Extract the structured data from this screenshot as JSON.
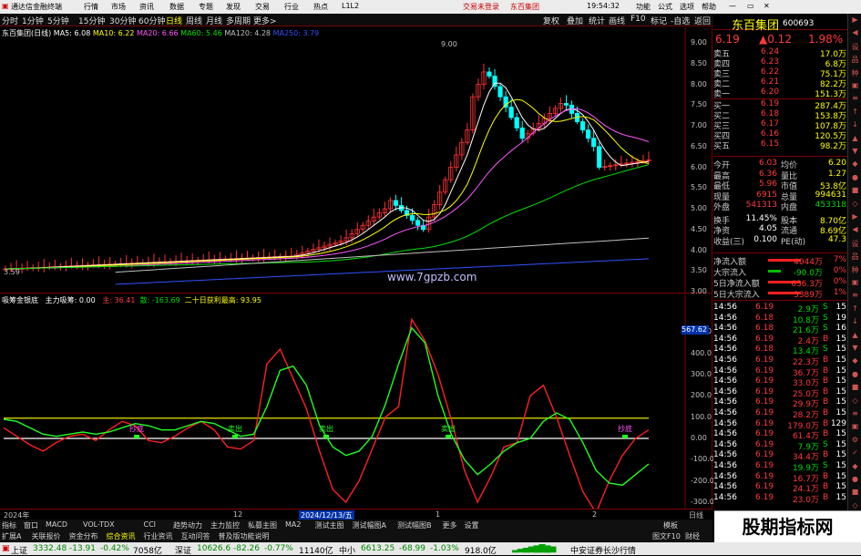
{
  "app": {
    "title": "通达信金融终端",
    "clock": "19:54:32",
    "menus": [
      "行情",
      "市场",
      "资讯",
      "数据",
      "专题",
      "发现",
      "交易",
      "行业",
      "热点",
      "L1L2"
    ],
    "trade_links": [
      "交易未登录",
      "东百集团"
    ],
    "right_menus": [
      "功能",
      "公式",
      "选项",
      "帮助"
    ]
  },
  "toolbar": {
    "periods": [
      "分时",
      "1分钟",
      "5分钟",
      "15分钟",
      "30分钟",
      "60分钟",
      "日线",
      "周线",
      "月线",
      "多周期",
      "更多>"
    ],
    "active": "日线",
    "actions": [
      "复权",
      "叠加",
      "统计",
      "画线",
      "F10",
      "标记",
      "-自选",
      "返回"
    ]
  },
  "chart": {
    "title": "东百集团(日线)",
    "ma": [
      {
        "l": "MA5: 6.08",
        "c": "#ffffff"
      },
      {
        "l": "MA10: 6.22",
        "c": "#ffff00"
      },
      {
        "l": "MA20: 6.66",
        "c": "#ff55ff"
      },
      {
        "l": "MA60: 5.46",
        "c": "#00e000"
      },
      {
        "l": "MA120: 4.28",
        "c": "#c0c0c0"
      },
      {
        "l": "MA250: 3.79",
        "c": "#3050ff"
      }
    ],
    "high_label": "9.00",
    "low_label": "3.59",
    "watermark": "www.7gpzb.com",
    "yticks": [
      "9.00",
      "8.50",
      "8.00",
      "7.50",
      "7.00",
      "6.50",
      "6.00",
      "5.50",
      "5.00",
      "4.50",
      "4.00",
      "3.50",
      "3.00"
    ]
  },
  "indicator": {
    "title": "吸筹金银底",
    "main": "主力吸筹: 0.00",
    "l1": "主: 36.41",
    "l2": "散: -163.69",
    "l3": "二十日获利最高: 93.95",
    "yticks": [
      "500.0",
      "400.0",
      "300.0",
      "200.0",
      "100.0",
      "0.00",
      "-100.0",
      "-200.0",
      "-300.0"
    ],
    "cur": "567.62",
    "marks": [
      "抄底",
      "卖出",
      "卖出",
      "卖出",
      "抄底"
    ]
  },
  "chart_data": [
    {
      "type": "line",
      "title": "吸筹金银底",
      "series": [
        {
          "name": "主",
          "values": [
            50,
            10,
            -30,
            -60,
            -20,
            10,
            20,
            -10,
            40,
            80,
            60,
            -10,
            -20,
            10,
            50,
            80,
            40,
            -40,
            -50,
            -10,
            350,
            420,
            280,
            140,
            -60,
            -240,
            -300,
            -200,
            -50,
            100,
            150,
            560,
            460,
            300,
            90,
            -150,
            -300,
            -180,
            -40,
            -20,
            200,
            250,
            100,
            -80,
            -250,
            -350,
            -200,
            -80,
            0,
            40
          ]
        },
        {
          "name": "散",
          "values": [
            90,
            80,
            50,
            20,
            10,
            20,
            30,
            20,
            30,
            50,
            70,
            60,
            40,
            40,
            60,
            80,
            70,
            40,
            10,
            20,
            150,
            320,
            340,
            250,
            60,
            -40,
            -80,
            -60,
            10,
            160,
            350,
            520,
            450,
            200,
            20,
            -100,
            -170,
            -120,
            -60,
            -20,
            0,
            80,
            120,
            90,
            -20,
            -150,
            -210,
            -220,
            -170,
            -120
          ]
        }
      ],
      "ylim": [
        -300,
        600
      ]
    },
    {
      "type": "bar",
      "title": "东百集团(日线)",
      "ylim": [
        3.0,
        9.2
      ],
      "y_ticks": [
        9,
        8.5,
        8,
        7.5,
        7,
        6.5,
        6,
        5.5,
        5,
        4.5,
        4,
        3.5,
        3
      ]
    }
  ],
  "quote": {
    "name": "东百集团",
    "code": "600693",
    "price": "6.19",
    "change": "▲0.12",
    "pct": "1.98%"
  },
  "orderbook": [
    {
      "l": "卖五",
      "p": "6.24",
      "v": "17.0万"
    },
    {
      "l": "卖四",
      "p": "6.23",
      "v": "6.8万"
    },
    {
      "l": "卖三",
      "p": "6.22",
      "v": "75.1万"
    },
    {
      "l": "卖二",
      "p": "6.21",
      "v": "82.2万"
    },
    {
      "l": "卖一",
      "p": "6.20",
      "v": "151.3万"
    },
    {
      "l": "买一",
      "p": "6.19",
      "v": "287.4万"
    },
    {
      "l": "买二",
      "p": "6.18",
      "v": "153.8万"
    },
    {
      "l": "买三",
      "p": "6.17",
      "v": "107.8万"
    },
    {
      "l": "买四",
      "p": "6.16",
      "v": "120.5万"
    },
    {
      "l": "买五",
      "p": "6.15",
      "v": "98.2万"
    }
  ],
  "stats": [
    {
      "a": "今开",
      "av": "6.03",
      "b": "均价",
      "bv": "6.20"
    },
    {
      "a": "最高",
      "av": "6.36",
      "b": "量比",
      "bv": "1.27"
    },
    {
      "a": "最低",
      "av": "5.96",
      "b": "市值",
      "bv": "53.8亿"
    },
    {
      "a": "现量",
      "av": "6915",
      "b": "总量",
      "bv": "994631"
    },
    {
      "a": "外盘",
      "av": "541313",
      "b": "内盘",
      "bv": "453318"
    },
    {
      "a": "换手",
      "av": "11.45%",
      "b": "股本",
      "bv": "8.70亿"
    },
    {
      "a": "净资",
      "av": "4.05",
      "b": "流通",
      "bv": "8.69亿"
    },
    {
      "a": "收益(三)",
      "av": "0.100",
      "b": "PE(动)",
      "bv": "47.3"
    }
  ],
  "flow": [
    {
      "l": "净流入额",
      "v": "4044万",
      "p": "7%"
    },
    {
      "l": "大宗流入",
      "v": "-90.0万",
      "p": "0%"
    },
    {
      "l": "5日净流入额",
      "v": "636.3万",
      "p": "0%"
    },
    {
      "l": "5日大宗流入",
      "v": "3389万",
      "p": "1%"
    }
  ],
  "ticks": [
    [
      "14:56",
      "6.19",
      "2.9万",
      "S",
      "15"
    ],
    [
      "14:56",
      "6.18",
      "10.8万",
      "S",
      "19"
    ],
    [
      "14:56",
      "6.18",
      "21.6万",
      "S",
      "16"
    ],
    [
      "14:56",
      "6.19",
      "2.4万",
      "B",
      "15"
    ],
    [
      "14:56",
      "6.18",
      "13.4万",
      "S",
      "15"
    ],
    [
      "14:56",
      "6.19",
      "22.3万",
      "B",
      "15"
    ],
    [
      "14:56",
      "6.19",
      "36.7万",
      "B",
      "15"
    ],
    [
      "14:56",
      "6.19",
      "33.0万",
      "B",
      "15"
    ],
    [
      "14:56",
      "6.19",
      "25.0万",
      "B",
      "15"
    ],
    [
      "14:56",
      "6.19",
      "29.9万",
      "B",
      "15"
    ],
    [
      "14:56",
      "6.19",
      "28.2万",
      "B",
      "15"
    ],
    [
      "14:56",
      "6.19",
      "179.0万",
      "B",
      "129"
    ],
    [
      "14:56",
      "6.19",
      "61.4万",
      "B",
      "15"
    ],
    [
      "14:56",
      "6.19",
      "7.9万",
      "S",
      "15"
    ],
    [
      "14:56",
      "6.19",
      "34.4万",
      "B",
      "15"
    ],
    [
      "14:56",
      "6.19",
      "19.9万",
      "S",
      "15"
    ],
    [
      "14:56",
      "6.19",
      "16.7万",
      "B",
      "15"
    ],
    [
      "14:56",
      "6.19",
      "24.1万",
      "B",
      "15"
    ],
    [
      "14:56",
      "6.19",
      "23.0万",
      "B",
      "15"
    ]
  ],
  "xaxis": {
    "l1": "2024年",
    "l2": "12",
    "l3": "2024/12/13/五",
    "l4": "1",
    "l5": "2",
    "right": "日线"
  },
  "tabs": [
    "指标",
    "窗口",
    "MACD",
    "VOL-TDX",
    "CCI",
    "趋势动力",
    "主力监控",
    "私募主图",
    "MA2",
    "测试主图",
    "测试幅图A",
    "测试幅图B",
    "更多",
    "设置"
  ],
  "tabs2": [
    "扩展A",
    "关联报价",
    "资金分布",
    "综合资讯",
    "行业资讯",
    "互动问答",
    "普及版功能说明"
  ],
  "tabs_right": [
    "模板",
    "图文F10",
    "财经"
  ],
  "status": {
    "sh": "上证",
    "sh_v": "3332.48",
    "sh_c": "-13.91",
    "sh_p": "-0.42%",
    "sh_a": "7058亿",
    "sz": "深证",
    "sz_v": "10626.6",
    "sz_c": "-82.26",
    "sz_p": "-0.77%",
    "sz_a": "11140亿",
    "zx": "中小",
    "zx_v": "6613.25",
    "zx_c": "-68.99",
    "zx_p": "-1.03%",
    "zx_a": "918.0亿",
    "broker": "中安证券长沙行情"
  },
  "ad": "股期指标网"
}
